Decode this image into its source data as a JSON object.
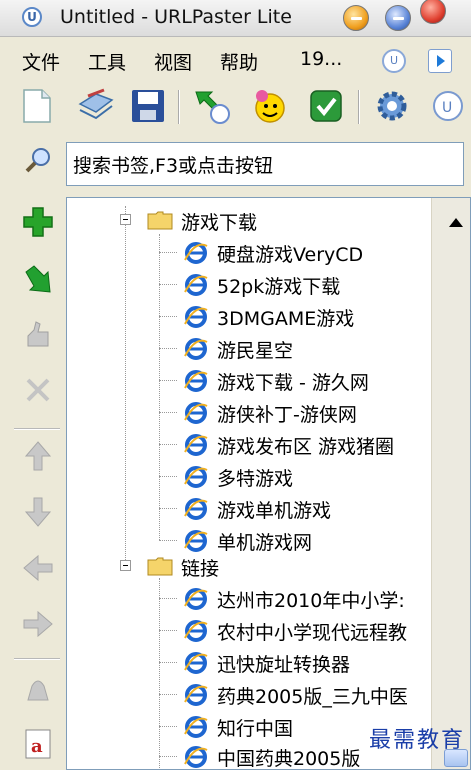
{
  "window": {
    "title": "Untitled - URLPaster Lite"
  },
  "menu": {
    "items": [
      "文件",
      "工具",
      "视图",
      "帮助",
      "19..."
    ]
  },
  "search": {
    "value": "搜索书签,F3或点击按钮"
  },
  "tree": {
    "groups": [
      {
        "label": "游戏下载",
        "items": [
          "硬盘游戏VeryCD",
          "52pk游戏下载",
          "3DMGAME游戏",
          "游民星空",
          "游戏下载 - 游久网",
          "游侠补丁-游侠网",
          "游戏发布区 游戏猪圈",
          "多特游戏",
          "游戏单机游戏",
          "单机游戏网"
        ]
      },
      {
        "label": "链接",
        "items": [
          "达州市2010年中小学:",
          "农村中小学现代远程教",
          "迅快旋址转换器",
          "药典2005版_三九中医",
          "知行中国",
          "中国药典2005版"
        ]
      }
    ]
  },
  "watermark": "最需教育",
  "colors": {
    "plus": "#22a020",
    "ie_blue": "#1e66d0",
    "folder": "#f5d46a"
  }
}
